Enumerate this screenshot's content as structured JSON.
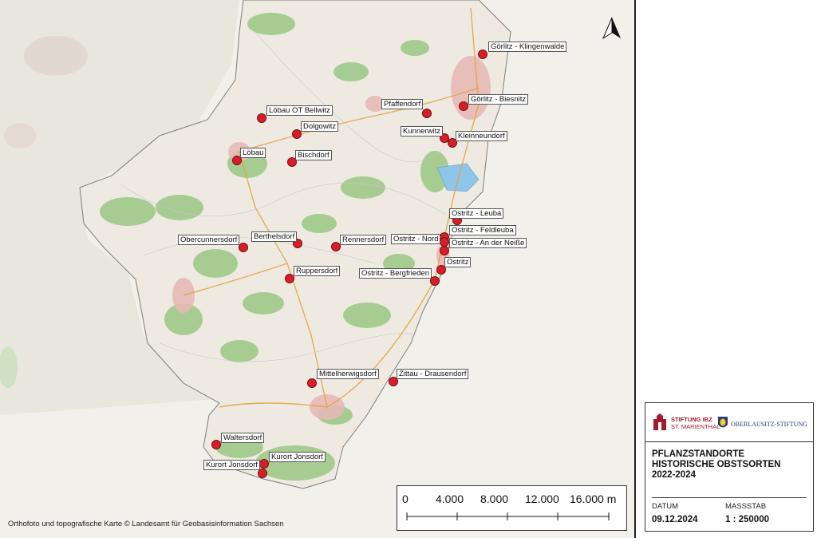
{
  "map": {
    "attribution": "Orthofoto und topografische Karte © Landesamt für Geobasisinformation Sachsen",
    "north_arrow": "north-arrow-icon",
    "marker_color": "#d81e2a",
    "places": [
      {
        "name": "Görlitz - Klingenwalde"
      },
      {
        "name": "Löbau OT Bellwitz"
      },
      {
        "name": "Pfaffendorf"
      },
      {
        "name": "Görlitz - Biesnitz"
      },
      {
        "name": "Dolgowitz"
      },
      {
        "name": "Kunnerwitz"
      },
      {
        "name": "Kleinneundorf"
      },
      {
        "name": "Löbau"
      },
      {
        "name": "Bischdorf"
      },
      {
        "name": "Ostritz - Leuba"
      },
      {
        "name": "Ostritz - Feldleuba"
      },
      {
        "name": "Obercunnersdorf"
      },
      {
        "name": "Berthelsdorf"
      },
      {
        "name": "Rennersdorf"
      },
      {
        "name": "Ostritz - Nord"
      },
      {
        "name": "Ostritz - An der Neiße"
      },
      {
        "name": "Ostritz"
      },
      {
        "name": "Ruppersdorf"
      },
      {
        "name": "Ostritz - Bergfrieden"
      },
      {
        "name": "Mittelherwigsdorf"
      },
      {
        "name": "Zittau - Drausendorf"
      },
      {
        "name": "Waltersdorf"
      },
      {
        "name": "Kurort Jonsdorf"
      },
      {
        "name": "Kurort Jonsdorf"
      }
    ]
  },
  "scalebar": {
    "ticks": [
      "0",
      "4.000",
      "8.000",
      "12.000",
      "16.000 m"
    ]
  },
  "info": {
    "logo_left_line1": "STIFTUNG IBZ",
    "logo_left_line2": "ST. MARIENTHAL",
    "logo_right": "OBERLAUSITZ-STIFTUNG",
    "title_line1": "PFLANZSTANDORTE",
    "title_line2": "HISTORISCHE OBSTSORTEN",
    "title_line3": "2022-2024",
    "date_caption": "DATUM",
    "date_value": "09.12.2024",
    "scale_caption": "MASSSTAB",
    "scale_value": "1 : 250000"
  }
}
